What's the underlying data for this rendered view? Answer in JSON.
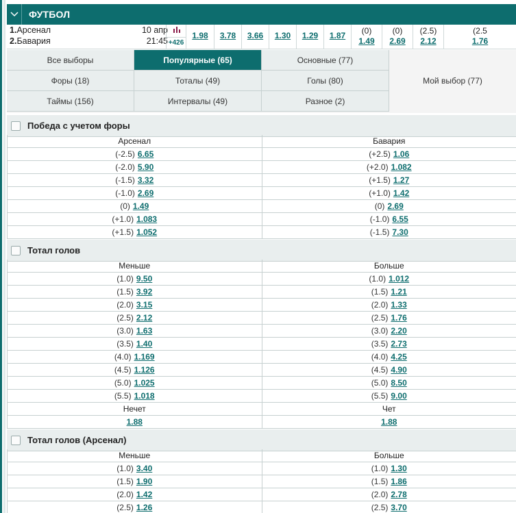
{
  "header": {
    "title": "ФУТБОЛ"
  },
  "event": {
    "team1_num": "1.",
    "team1": "Арсенал",
    "team2_num": "2.",
    "team2": "Бавария",
    "date": "10 апр",
    "time": "21:45",
    "more_markets": "+426",
    "odds": [
      {
        "p": "",
        "v": "1.98"
      },
      {
        "p": "",
        "v": "3.78"
      },
      {
        "p": "",
        "v": "3.66"
      },
      {
        "p": "",
        "v": "1.30"
      },
      {
        "p": "",
        "v": "1.29"
      },
      {
        "p": "",
        "v": "1.87"
      },
      {
        "p": "(0)",
        "v": "1.49"
      },
      {
        "p": "(0)",
        "v": "2.69"
      },
      {
        "p": "(2.5)",
        "v": "2.12"
      },
      {
        "p": "(2.5",
        "v": "1.76"
      }
    ]
  },
  "tabs": {
    "all": "Все выборы",
    "popular": "Популярные (65)",
    "main": "Основные (77)",
    "handicaps": "Форы (18)",
    "totals": "Тоталы (49)",
    "goals": "Голы (80)",
    "mine": "Мой выбор (77)",
    "halves": "Таймы (156)",
    "intervals": "Интервалы (49)",
    "misc": "Разное (2)"
  },
  "handicap": {
    "title": "Победа с учетом форы",
    "col1": "Арсенал",
    "col2": "Бавария",
    "rows": [
      {
        "p1": "(-2.5)",
        "v1": "6.65",
        "p2": "(+2.5)",
        "v2": "1.06"
      },
      {
        "p1": "(-2.0)",
        "v1": "5.90",
        "p2": "(+2.0)",
        "v2": "1.082"
      },
      {
        "p1": "(-1.5)",
        "v1": "3.32",
        "p2": "(+1.5)",
        "v2": "1.27"
      },
      {
        "p1": "(-1.0)",
        "v1": "2.69",
        "p2": "(+1.0)",
        "v2": "1.42"
      },
      {
        "p1": "(0)",
        "v1": "1.49",
        "p2": "(0)",
        "v2": "2.69"
      },
      {
        "p1": "(+1.0)",
        "v1": "1.083",
        "p2": "(-1.0)",
        "v2": "6.55"
      },
      {
        "p1": "(+1.5)",
        "v1": "1.052",
        "p2": "(-1.5)",
        "v2": "7.30"
      }
    ]
  },
  "totals": {
    "title": "Тотал голов",
    "col1": "Меньше",
    "col2": "Больше",
    "rows": [
      {
        "p1": "(1.0)",
        "v1": "9.50",
        "p2": "(1.0)",
        "v2": "1.012"
      },
      {
        "p1": "(1.5)",
        "v1": "3.92",
        "p2": "(1.5)",
        "v2": "1.21"
      },
      {
        "p1": "(2.0)",
        "v1": "3.15",
        "p2": "(2.0)",
        "v2": "1.33"
      },
      {
        "p1": "(2.5)",
        "v1": "2.12",
        "p2": "(2.5)",
        "v2": "1.76"
      },
      {
        "p1": "(3.0)",
        "v1": "1.63",
        "p2": "(3.0)",
        "v2": "2.20"
      },
      {
        "p1": "(3.5)",
        "v1": "1.40",
        "p2": "(3.5)",
        "v2": "2.73"
      },
      {
        "p1": "(4.0)",
        "v1": "1.169",
        "p2": "(4.0)",
        "v2": "4.25"
      },
      {
        "p1": "(4.5)",
        "v1": "1.126",
        "p2": "(4.5)",
        "v2": "4.90"
      },
      {
        "p1": "(5.0)",
        "v1": "1.025",
        "p2": "(5.0)",
        "v2": "8.50"
      },
      {
        "p1": "(5.5)",
        "v1": "1.018",
        "p2": "(5.5)",
        "v2": "9.00"
      }
    ],
    "odd_label": "Нечет",
    "even_label": "Чет",
    "odd_value": "1.88",
    "even_value": "1.88"
  },
  "team_totals": {
    "title": "Тотал голов (Арсенал)",
    "col1": "Меньше",
    "col2": "Больше",
    "rows": [
      {
        "p1": "(1.0)",
        "v1": "3.40",
        "p2": "(1.0)",
        "v2": "1.30"
      },
      {
        "p1": "(1.5)",
        "v1": "1.90",
        "p2": "(1.5)",
        "v2": "1.86"
      },
      {
        "p1": "(2.0)",
        "v1": "1.42",
        "p2": "(2.0)",
        "v2": "2.78"
      },
      {
        "p1": "(2.5)",
        "v1": "1.26",
        "p2": "(2.5)",
        "v2": "3.70"
      }
    ]
  },
  "colors": {
    "accent": "#0d6d6e",
    "bar_icon": "#8a1c4a"
  },
  "icons": {
    "collapse": "chevron-down-icon",
    "stats": "bar-chart-icon"
  }
}
